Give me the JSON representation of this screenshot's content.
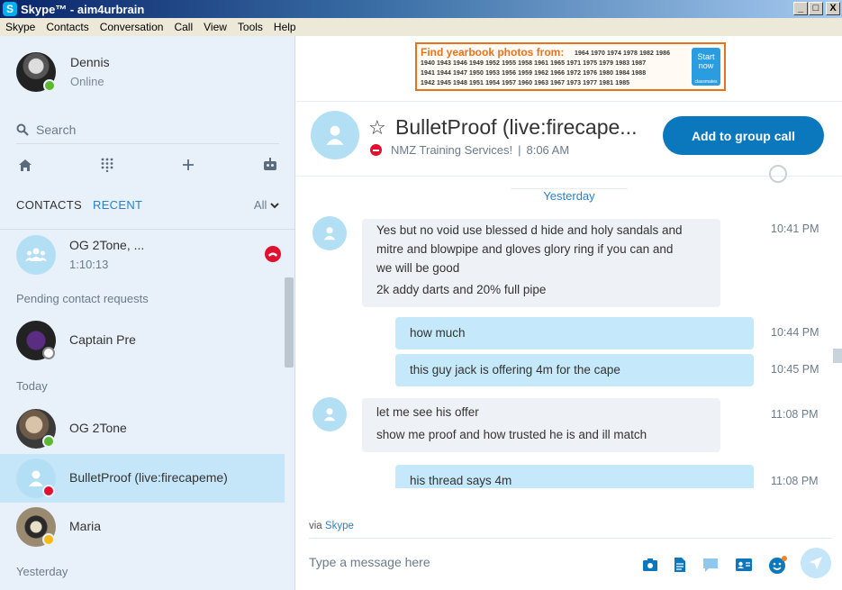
{
  "window": {
    "title": "Skype™ - aim4urbrain",
    "skype_glyph": "S",
    "min": "_",
    "max": "□",
    "close": "X"
  },
  "menu": [
    "Skype",
    "Contacts",
    "Conversation",
    "Call",
    "View",
    "Tools",
    "Help"
  ],
  "profile": {
    "name": "Dennis",
    "status": "Online"
  },
  "search": {
    "placeholder": "Search"
  },
  "tabs": {
    "contacts": "CONTACTS",
    "recent": "RECENT",
    "filter": "All"
  },
  "recent_call": {
    "name": "OG 2Tone, ...",
    "duration": "1:10:13"
  },
  "sections": {
    "pending": "Pending contact requests",
    "today": "Today",
    "yesterday": "Yesterday"
  },
  "contacts": [
    {
      "name": "Captain Pre",
      "status": "pending"
    },
    {
      "name": "OG 2Tone",
      "status": "online"
    },
    {
      "name": "BulletProof (live:firecapeme)",
      "status": "dnd"
    },
    {
      "name": "Maria",
      "status": "away"
    }
  ],
  "ad": {
    "title": "Find yearbook photos from:",
    "years": [
      "1964 1970 1974 1978 1982 1986",
      "1940 1943 1946 1949 1952 1955 1958 1961 1965 1971 1975 1979 1983 1987",
      "1941 1944 1947 1950 1953 1956 1959 1962 1966 1972 1976 1980 1984 1988",
      "1942 1945 1948 1951 1954 1957 1960 1963 1967 1973 1977 1981 1985"
    ],
    "button": "Start now",
    "brand": "classmates"
  },
  "conversation": {
    "title": "BulletProof (live:firecape...",
    "mood": "NMZ Training Services!",
    "separator": "|",
    "time": "8:06 AM",
    "group_call": "Add to group call"
  },
  "day_separator": "Yesterday",
  "messages": [
    {
      "dir": "in",
      "lines": [
        "Yes but no void use blessed d hide and holy sandals and",
        "mitre and blowpipe and gloves glory ring if you can and",
        "we will be good"
      ],
      "time": "10:41 PM"
    },
    {
      "dir": "in",
      "lines": [
        "2k addy darts and 20% full pipe"
      ],
      "time": ""
    },
    {
      "dir": "out",
      "lines": [
        "how much"
      ],
      "time": "10:44 PM"
    },
    {
      "dir": "out",
      "lines": [
        "this guy jack is offering 4m for the cape"
      ],
      "time": "10:45 PM"
    },
    {
      "dir": "in",
      "lines": [
        "let me see his offer"
      ],
      "time": "11:08 PM"
    },
    {
      "dir": "in",
      "lines": [
        "show me proof and how trusted he is and ill match"
      ],
      "time": ""
    },
    {
      "dir": "out",
      "lines": [
        "his thread says 4m"
      ],
      "time": "11:08 PM"
    }
  ],
  "footer": {
    "via": "via",
    "via_link": "Skype",
    "composer_placeholder": "Type a message here"
  },
  "colors": {
    "accent": "#0b78bd",
    "sidebar_bg": "#e8f1f9",
    "outgoing_bubble": "#c5e9fa",
    "incoming_bubble": "#eef1f5",
    "dnd": "#e0102f",
    "online": "#5cb82f"
  }
}
